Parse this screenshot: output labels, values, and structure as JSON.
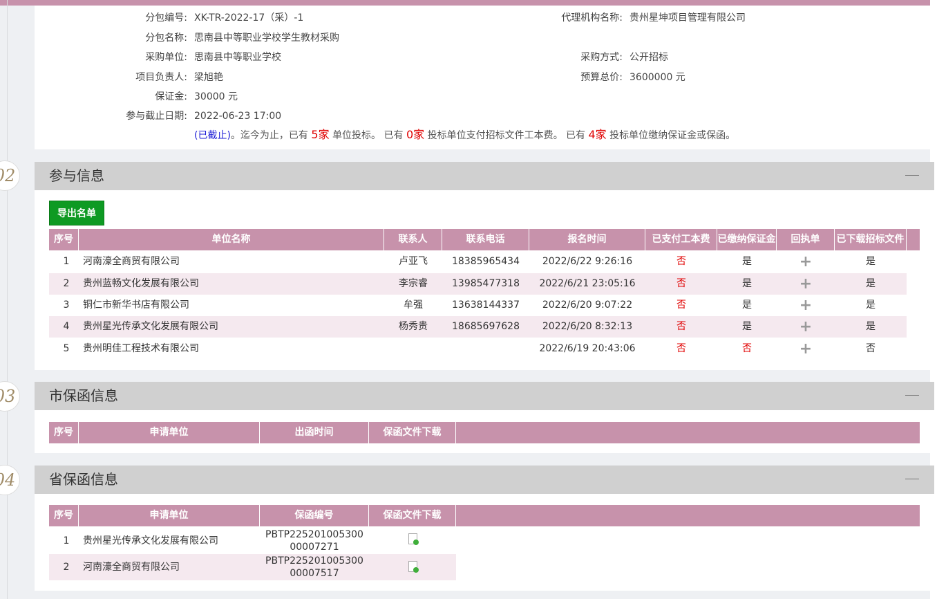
{
  "info": {
    "package_no": {
      "label": "分包编号:",
      "value": "XK-TR-2022-17（采）-1"
    },
    "agency": {
      "label": "代理机构名称:",
      "value": "贵州星坤项目管理有限公司"
    },
    "package_name": {
      "label": "分包名称:",
      "value": "思南县中等职业学校学生教材采购"
    },
    "buyer": {
      "label": "采购单位:",
      "value": "思南县中等职业学校"
    },
    "method": {
      "label": "采购方式:",
      "value": "公开招标"
    },
    "manager": {
      "label": "项目负责人:",
      "value": "梁旭艳"
    },
    "budget": {
      "label": "预算总价:",
      "value": "3600000 元"
    },
    "deposit": {
      "label": "保证金:",
      "value": "30000 元"
    },
    "deadline": {
      "label": "参与截止日期:",
      "value": "2022-06-23 17:00"
    },
    "note": {
      "status": "(已截止)",
      "t1": "。迄今为止，已有 ",
      "bid_count": "5家",
      "t2": " 单位投标。 已有 ",
      "fee_count": "0家",
      "t3": " 投标单位支付招标文件工本费。 已有 ",
      "deposit_count": "4家",
      "t4": " 投标单位缴纳保证金或保函。"
    }
  },
  "sections": {
    "s02": {
      "num": "02",
      "title": "参与信息"
    },
    "s03": {
      "num": "03",
      "title": "市保函信息"
    },
    "s04": {
      "num": "04",
      "title": "省保函信息"
    }
  },
  "participation": {
    "export_label": "导出名单",
    "headers": [
      "序号",
      "单位名称",
      "联系人",
      "联系电话",
      "报名时间",
      "已支付工本费",
      "已缴纳保证金",
      "回执单",
      "已下载招标文件"
    ],
    "rows": [
      {
        "no": "1",
        "name": "河南濠全商贸有限公司",
        "contact": "卢亚飞",
        "phone": "18385965434",
        "time": "2022/6/22 9:26:16",
        "fee": "否",
        "deposit": "是",
        "receipt": "+",
        "downloaded": "是"
      },
      {
        "no": "2",
        "name": "贵州蓝畅文化发展有限公司",
        "contact": "李宗睿",
        "phone": "13985477318",
        "time": "2022/6/21 23:05:16",
        "fee": "否",
        "deposit": "是",
        "receipt": "+",
        "downloaded": "是"
      },
      {
        "no": "3",
        "name": "铜仁市新华书店有限公司",
        "contact": "牟强",
        "phone": "13638144337",
        "time": "2022/6/20 9:07:22",
        "fee": "否",
        "deposit": "是",
        "receipt": "+",
        "downloaded": "是"
      },
      {
        "no": "4",
        "name": "贵州星光传承文化发展有限公司",
        "contact": "杨秀贵",
        "phone": "18685697628",
        "time": "2022/6/20 8:32:13",
        "fee": "否",
        "deposit": "是",
        "receipt": "+",
        "downloaded": "是"
      },
      {
        "no": "5",
        "name": "贵州明佳工程技术有限公司",
        "contact": "",
        "phone": "",
        "time": "2022/6/19 20:43:06",
        "fee": "否",
        "deposit": "否",
        "receipt": "+",
        "downloaded": "否"
      }
    ]
  },
  "city_guarantee": {
    "headers": [
      "序号",
      "申请单位",
      "出函时间",
      "保函文件下载"
    ]
  },
  "province_guarantee": {
    "headers": [
      "序号",
      "申请单位",
      "保函编号",
      "保函文件下载"
    ],
    "rows": [
      {
        "no": "1",
        "name": "贵州星光传承文化发展有限公司",
        "code_l1": "PBTP225201005300",
        "code_l2": "00007271",
        "file_icon": "download-file-icon"
      },
      {
        "no": "2",
        "name": "河南濠全商贸有限公司",
        "code_l1": "PBTP225201005300",
        "code_l2": "00007517",
        "file_icon": "download-file-icon"
      }
    ]
  }
}
